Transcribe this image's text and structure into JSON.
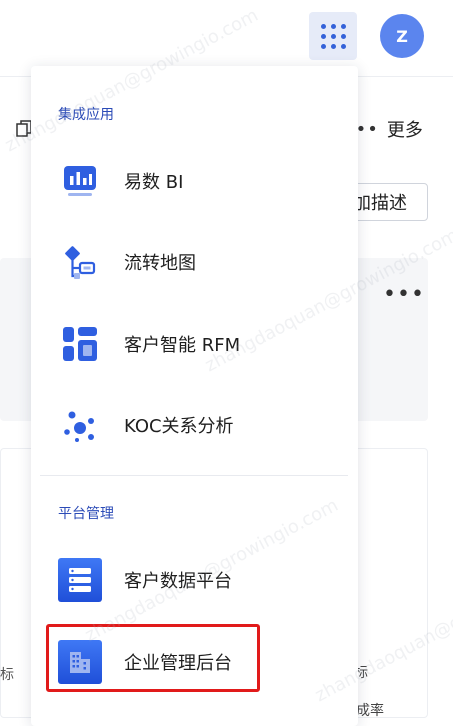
{
  "header": {
    "avatar_initial": "Z",
    "apps_button": "apps-grid-icon"
  },
  "background": {
    "more_label": "更多",
    "add_description_label": "加描述",
    "left_fragment": "标",
    "right_fragment_1": "目标",
    "right_fragment_2": "成率"
  },
  "menu": {
    "section_integrated_apps": "集成应用",
    "items_apps": [
      {
        "label": "易数 BI",
        "icon": "bar-chart-icon"
      },
      {
        "label": "流转地图",
        "icon": "flow-map-icon"
      },
      {
        "label": "客户智能 RFM",
        "icon": "layout-grid-icon"
      },
      {
        "label": "KOC关系分析",
        "icon": "network-dots-icon"
      }
    ],
    "section_platform_mgmt": "平台管理",
    "items_platform": [
      {
        "label": "客户数据平台",
        "icon": "database-stack-icon"
      },
      {
        "label": "企业管理后台",
        "icon": "building-icon"
      }
    ]
  },
  "watermark_text": "zhangdaoquan@growingio.com",
  "colors": {
    "accent": "#3562d9",
    "avatar_bg": "#5b85ee",
    "section_title": "#2b4bb7",
    "highlight_border": "#e11a1a"
  }
}
